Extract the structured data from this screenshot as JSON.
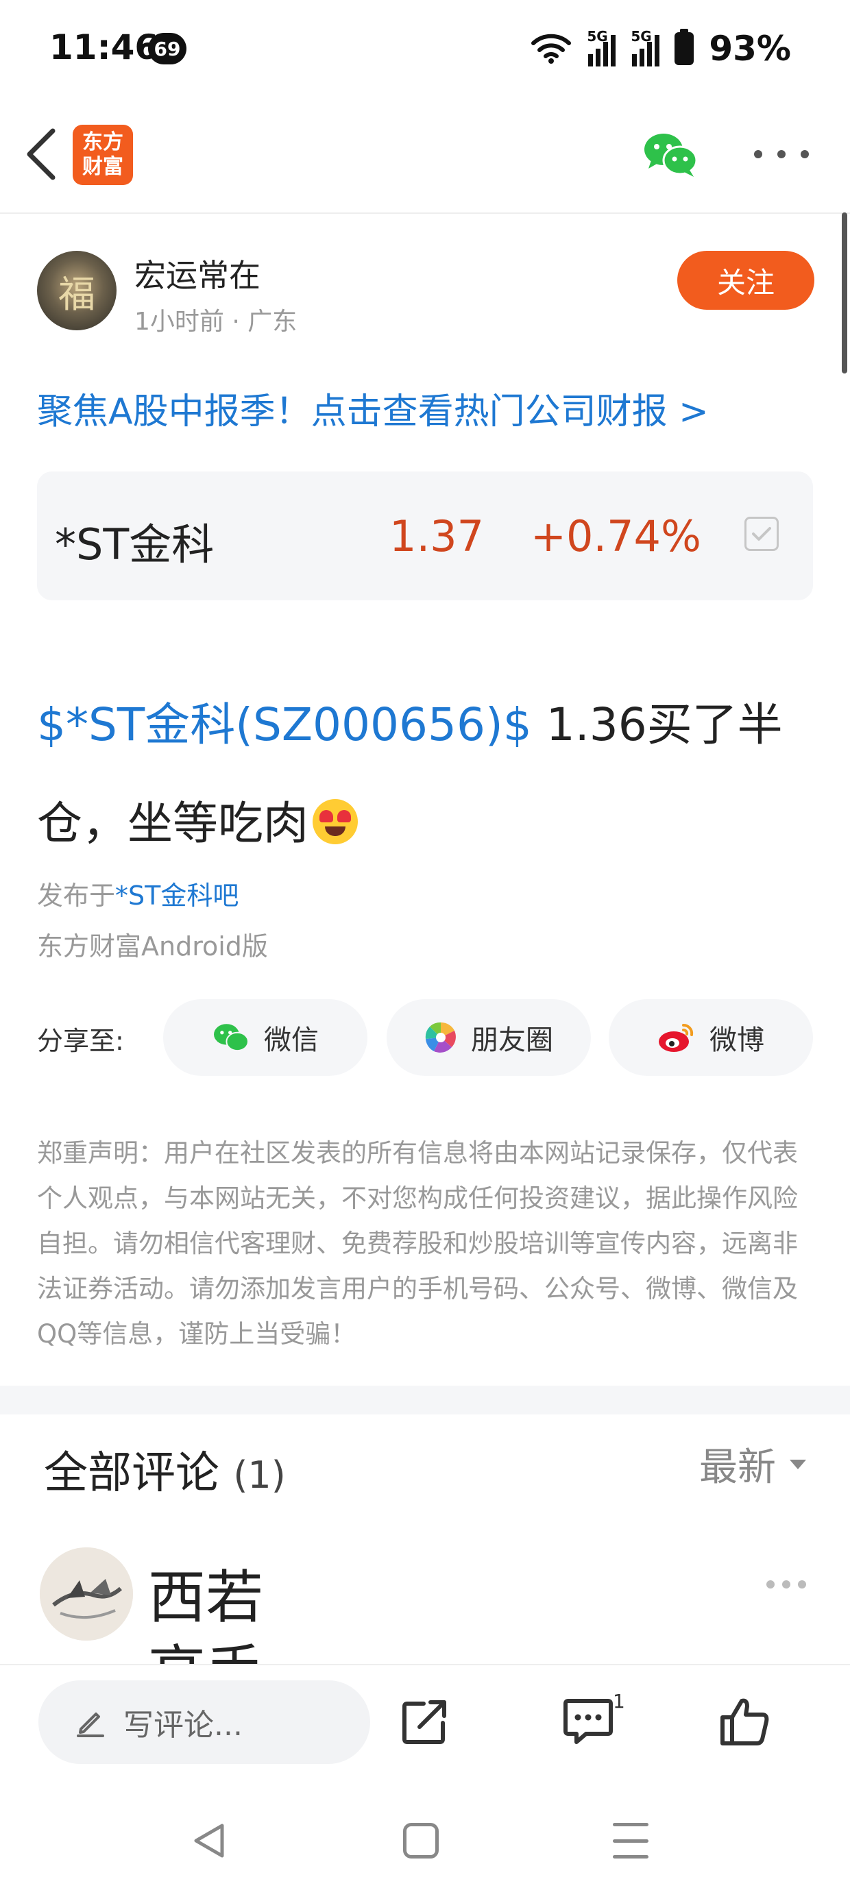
{
  "status_bar": {
    "time": "11:46",
    "notification_badge": "69",
    "network_1": "5G",
    "network_2": "5G",
    "battery": "93%"
  },
  "header": {
    "logo_line1": "东方",
    "logo_line2": "财富",
    "icons": [
      "back-icon",
      "wechat-icon",
      "more-icon"
    ]
  },
  "post": {
    "author": {
      "name": "宏运常在",
      "meta": "1小时前 · 广东",
      "avatar_char": "福"
    },
    "follow_label": "关注",
    "promo_link": "聚焦A股中报季！点击查看热门公司财报 >",
    "stock": {
      "name": "*ST金科",
      "price": "1.37",
      "change": "+0.74%"
    },
    "body_tag": "$*ST金科(SZ000656)$",
    "body_text": " 1.36买了半仓，坐等吃肉",
    "published_prefix": "发布于",
    "published_forum": "*ST金科吧",
    "client": "东方财富Android版"
  },
  "share": {
    "label": "分享至:",
    "options": [
      {
        "label": "微信",
        "icon": "wechat-icon"
      },
      {
        "label": "朋友圈",
        "icon": "moments-icon"
      },
      {
        "label": "微博",
        "icon": "weibo-icon"
      }
    ]
  },
  "disclaimer": "郑重声明：用户在社区发表的所有信息将由本网站记录保存，仅代表个人观点，与本网站无关，不对您构成任何投资建议，据此操作风险自担。请勿相信代客理财、免费荐股和炒股培训等宣传内容，远离非法证券活动。请勿添加发言用户的手机号码、公众号、微博、微信及QQ等信息，谨防上当受骗！",
  "comments": {
    "title": "全部评论",
    "count": "(1)",
    "sort": "最新",
    "first": {
      "name": "西若",
      "peek": "高手"
    }
  },
  "bottom_bar": {
    "input_placeholder": "写评论...",
    "comment_count": "1"
  },
  "colors": {
    "accent": "#f25c1e",
    "link": "#1e78d2",
    "up": "#d0461e"
  }
}
